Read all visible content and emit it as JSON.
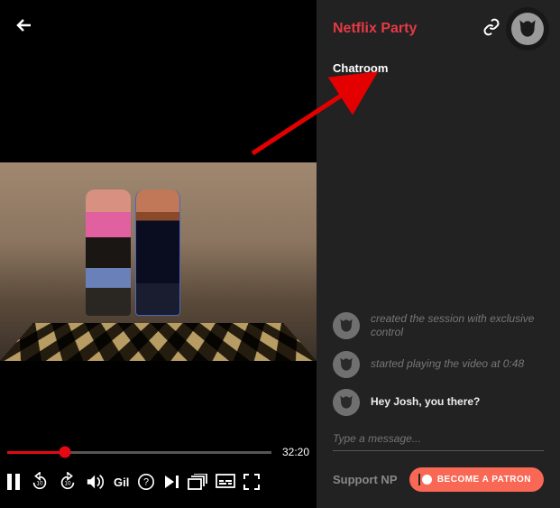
{
  "video": {
    "time_remaining": "32:20",
    "title_short": "Gil",
    "progress_pct": 22
  },
  "chat": {
    "app_title": "Netflix Party",
    "section_label": "Chatroom",
    "messages": [
      {
        "kind": "system",
        "text": "created the session with exclusive control"
      },
      {
        "kind": "system",
        "text": "started playing the video at 0:48"
      },
      {
        "kind": "user",
        "text": "Hey Josh, you there?"
      }
    ],
    "input_placeholder": "Type a message...",
    "support_label": "Support NP",
    "patron_label": "BECOME A PATRON"
  },
  "colors": {
    "accent_red": "#e50914",
    "np_red": "#e63946",
    "patron": "#f86855"
  }
}
